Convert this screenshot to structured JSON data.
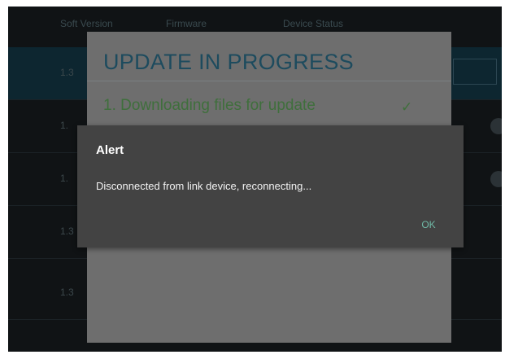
{
  "background": {
    "header": {
      "col1": "Soft Version",
      "col2": "Firmware",
      "col3": "Device Status"
    },
    "rows": [
      {
        "version": "1.3"
      },
      {
        "version": "1."
      },
      {
        "version": "1."
      },
      {
        "version": "1.3"
      },
      {
        "version": "1.3"
      }
    ]
  },
  "update_dialog": {
    "title": "UPDATE IN PROGRESS",
    "steps": [
      {
        "label": "1. Downloading files for update",
        "status_icon": "check-icon",
        "status_glyph": "✓"
      }
    ]
  },
  "alert": {
    "title": "Alert",
    "message": "Disconnected from link device, reconnecting...",
    "ok_label": "OK"
  },
  "colors": {
    "screen_bg": "#101315",
    "panel_bg": "#6e6e6e",
    "alert_bg": "#434343",
    "title_blue": "#1d4b5e",
    "step_green": "#3f6f3c",
    "accent_teal": "#6fb9a6"
  }
}
